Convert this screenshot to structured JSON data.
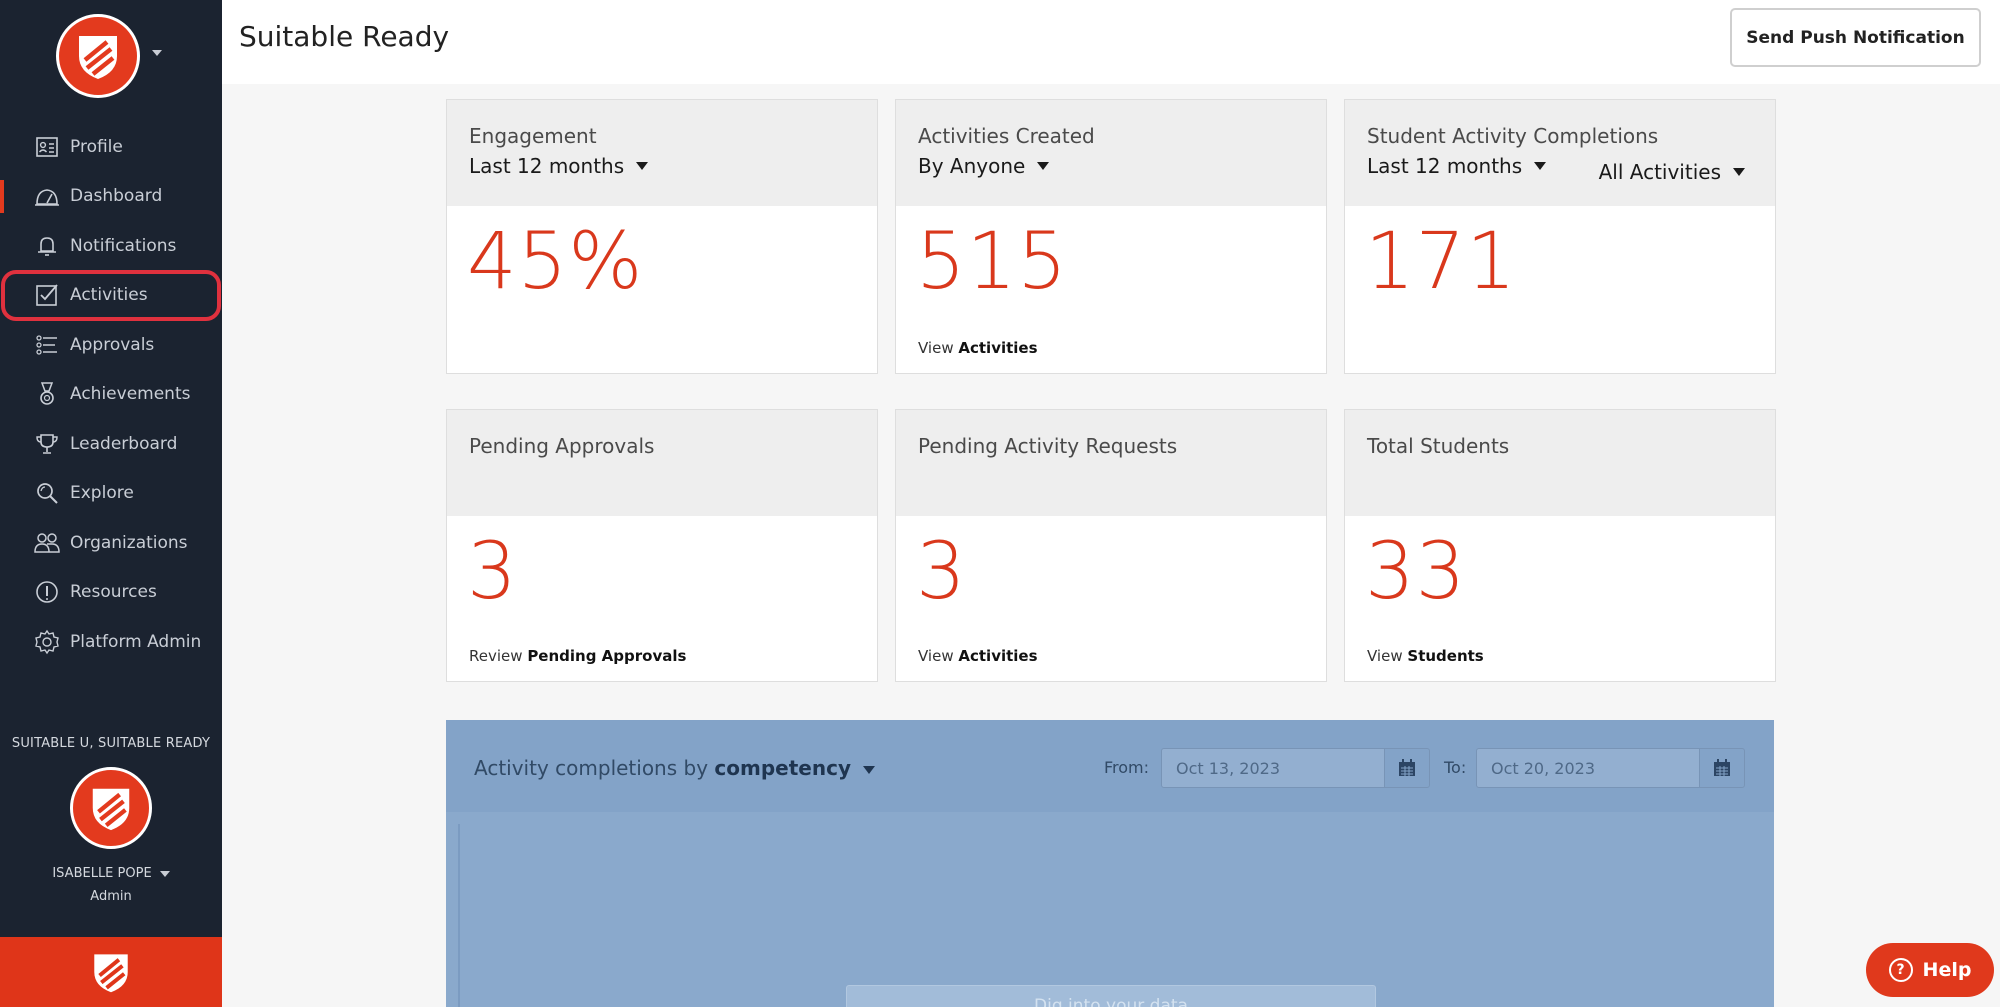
{
  "header": {
    "title": "Suitable Ready",
    "push_button": "Send Push Notification"
  },
  "sidebar": {
    "items": [
      {
        "label": "Profile",
        "icon": "profile-card-icon"
      },
      {
        "label": "Dashboard",
        "icon": "dashboard-gauge-icon"
      },
      {
        "label": "Notifications",
        "icon": "bell-icon"
      },
      {
        "label": "Activities",
        "icon": "checkbox-icon"
      },
      {
        "label": "Approvals",
        "icon": "checklist-icon"
      },
      {
        "label": "Achievements",
        "icon": "medal-icon"
      },
      {
        "label": "Leaderboard",
        "icon": "trophy-icon"
      },
      {
        "label": "Explore",
        "icon": "magnifier-icon"
      },
      {
        "label": "Organizations",
        "icon": "people-icon"
      },
      {
        "label": "Resources",
        "icon": "info-circle-icon"
      },
      {
        "label": "Platform Admin",
        "icon": "gear-icon"
      }
    ],
    "active_item": "Dashboard",
    "highlighted_item": "Activities",
    "org_label": "SUITABLE U, SUITABLE READY",
    "user_name": "ISABELLE POPE",
    "user_role": "Admin"
  },
  "cards": {
    "engagement": {
      "title": "Engagement",
      "dropdown": "Last 12 months",
      "value": "45%"
    },
    "activities_created": {
      "title": "Activities Created",
      "dropdown": "By Anyone",
      "value": "515",
      "link_prefix": "View",
      "link_label": "Activities"
    },
    "completions": {
      "title": "Student Activity Completions",
      "dropdown": "Last 12 months",
      "dropdown2": "All Activities",
      "value": "171"
    },
    "pending_approvals": {
      "title": "Pending Approvals",
      "value": "3",
      "link_prefix": "Review",
      "link_label": "Pending Approvals"
    },
    "pending_requests": {
      "title": "Pending Activity Requests",
      "value": "3",
      "link_prefix": "View",
      "link_label": "Activities"
    },
    "total_students": {
      "title": "Total Students",
      "value": "33",
      "link_prefix": "View",
      "link_label": "Students"
    }
  },
  "chart_panel": {
    "title_prefix": "Activity completions by",
    "title_dropdown": "competency",
    "from_label": "From:",
    "from_value": "Oct 13, 2023",
    "to_label": "To:",
    "to_value": "Oct 20, 2023",
    "dig_button": "Dig into your data"
  },
  "help": {
    "label": "Help"
  },
  "colors": {
    "accent": "#e33a1e",
    "sidebar": "#1b2330",
    "number": "#d9381c"
  }
}
